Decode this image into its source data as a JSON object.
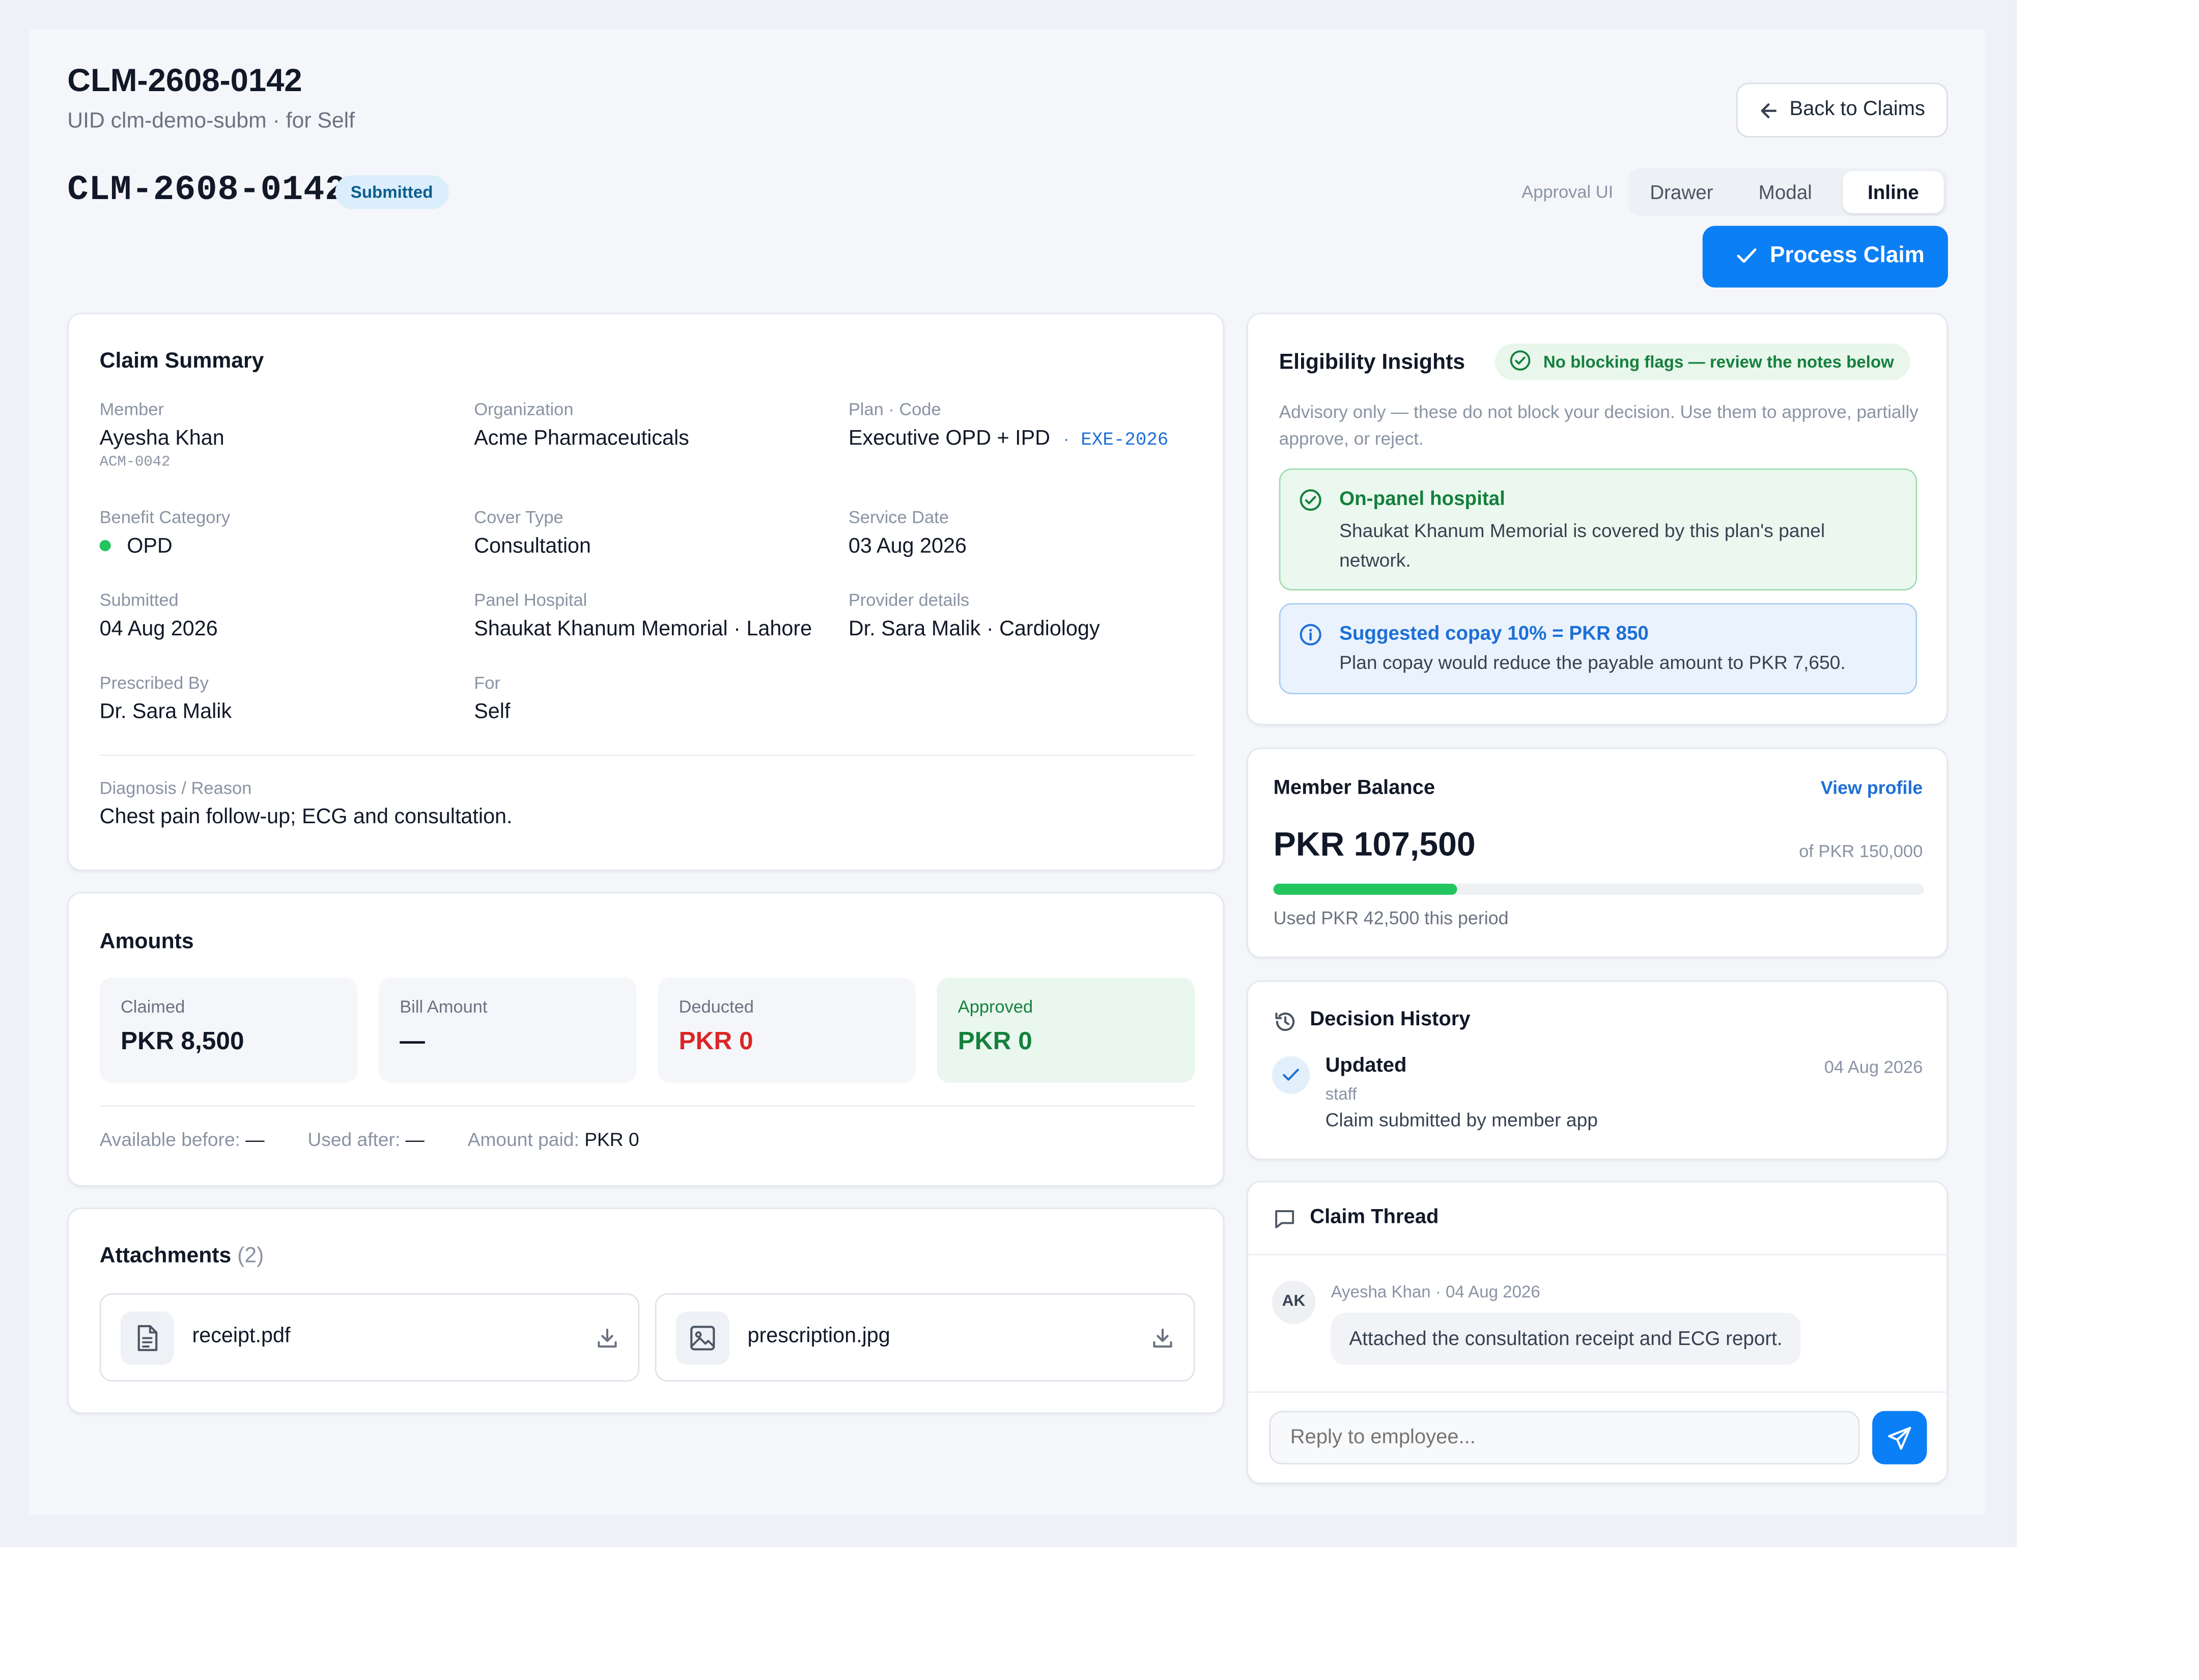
{
  "header": {
    "title": "CLM-2608-0142",
    "subtitle": "UID clm-demo-subm · for Self",
    "back_label": "Back to Claims",
    "claim_id": "CLM-2608-0142",
    "status_badge": "Submitted",
    "approval_ui_label": "Approval UI",
    "approval_options": [
      "Drawer",
      "Modal",
      "Inline"
    ],
    "approval_selected": "Inline",
    "process_label": "Process Claim"
  },
  "summary": {
    "title": "Claim Summary",
    "member_label": "Member",
    "member_name": "Ayesha Khan",
    "member_code": "ACM-0042",
    "org_label": "Organization",
    "org_value": "Acme Pharmaceuticals",
    "plan_label": "Plan · Code",
    "plan_value": "Executive OPD + IPD",
    "plan_sep": "·",
    "plan_code": "EXE-2026",
    "benefit_label": "Benefit Category",
    "benefit_value": "OPD",
    "cover_label": "Cover Type",
    "cover_value": "Consultation",
    "service_label": "Service Date",
    "service_value": "03 Aug 2026",
    "submitted_label": "Submitted",
    "submitted_value": "04 Aug 2026",
    "panel_label": "Panel Hospital",
    "panel_value": "Shaukat Khanum Memorial · Lahore",
    "provider_label": "Provider details",
    "provider_value": "Dr. Sara Malik · Cardiology",
    "prescribed_label": "Prescribed By",
    "prescribed_value": "Dr. Sara Malik",
    "for_label": "For",
    "for_value": "Self",
    "diagnosis_label": "Diagnosis / Reason",
    "diagnosis_value": "Chest pain follow-up; ECG and consultation."
  },
  "amounts": {
    "title": "Amounts",
    "claimed_label": "Claimed",
    "claimed_value": "PKR 8,500",
    "bill_label": "Bill Amount",
    "bill_value": "—",
    "deducted_label": "Deducted",
    "deducted_value": "PKR 0",
    "approved_label": "Approved",
    "approved_value": "PKR 0",
    "available_label": "Available before:",
    "available_value": "—",
    "used_label": "Used after:",
    "used_value": "—",
    "paid_label": "Amount paid:",
    "paid_value": "PKR 0"
  },
  "attachments": {
    "title": "Attachments",
    "count": "(2)",
    "files": [
      {
        "name": "receipt.pdf",
        "icon": "file-text-icon"
      },
      {
        "name": "prescription.jpg",
        "icon": "image-icon"
      }
    ]
  },
  "eligibility": {
    "title": "Eligibility Insights",
    "badge": "No blocking flags — review the notes below",
    "advisory": "Advisory only — these do not block your decision. Use them to approve, partially approve, or reject.",
    "notes": [
      {
        "title": "On-panel hospital",
        "text": "Shaukat Khanum Memorial is covered by this plan's panel network.",
        "tone": "success"
      },
      {
        "title": "Suggested copay 10% = PKR 850",
        "text": "Plan copay would reduce the payable amount to PKR 7,650.",
        "tone": "info"
      }
    ]
  },
  "balance": {
    "title": "Member Balance",
    "view_profile": "View profile",
    "amount": "PKR 107,500",
    "of_total": "of PKR 150,000",
    "used_fraction": 0.2833,
    "used_text": "Used PKR 42,500 this period"
  },
  "history": {
    "title": "Decision History",
    "entries": [
      {
        "status": "Updated",
        "date": "04 Aug 2026",
        "role": "staff",
        "note": "Claim submitted by member app"
      }
    ]
  },
  "thread": {
    "title": "Claim Thread",
    "messages": [
      {
        "initials": "AK",
        "meta": "Ayesha Khan · 04 Aug 2026",
        "text": "Attached the consultation receipt and ECG report."
      }
    ],
    "reply_placeholder": "Reply to employee..."
  },
  "colors": {
    "primary": "#0b7ff5",
    "success": "#15803d",
    "danger": "#dc2626",
    "info": "#1d6fd6",
    "progress": "#22c55e"
  }
}
